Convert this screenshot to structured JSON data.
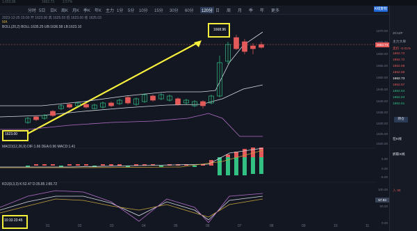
{
  "topbar": {
    "t1": "1,653.96",
    "t2": "1662.73",
    "t3": "2.57%"
  },
  "toolbar": {
    "items": [
      "分时",
      "5日",
      "日K",
      "周K",
      "月K",
      "季K",
      "年K",
      "主力",
      "1分",
      "5分",
      "10分",
      "15分",
      "30分",
      "60分",
      "120分",
      "日",
      "周",
      "月",
      "季",
      "年",
      "更多"
    ],
    "active_index": 14,
    "blue_badge": "K线复权"
  },
  "info": {
    "line1": "2023-12-25 15:00  开 1623.00  高 1625.03  低 1623.00  收 1625.03",
    "ma": "MA",
    "boll": "BOLL(20,2)  BOLL:1635.25  UB:1636.58  LB:1623.10"
  },
  "annotations": {
    "price_top": "1668.96",
    "price_low": "1623.00",
    "time_box": "10:33 23:45"
  },
  "axis": {
    "ticks": [
      "1670.00",
      "1665.00",
      "1660.00",
      "1655.00",
      "1650.00",
      "1645.00",
      "1640.00",
      "1635.00",
      "1630.00",
      "1625.00",
      "1620.00"
    ],
    "last_price": "1662.73",
    "macd_ticks": [
      "5.00",
      "0.00",
      "-5.00"
    ],
    "kdj_ticks": [
      "100.00",
      "50.00",
      "0.00"
    ],
    "kdj_tag": "57.93"
  },
  "panes": {
    "macd": "MACD(12,26,9)  DIF:1.66  DEA:0.96  MACD:1.41",
    "kdj": "KDJ(9,3,3)  K:52.47  D:35.85  J:85.72"
  },
  "xaxis": [
    "01",
    "02",
    "03",
    "04",
    "05",
    "06",
    "07",
    "08",
    "09",
    "10",
    "11"
  ],
  "right_panel": {
    "code": "2C1ZF",
    "name": "主力大单",
    "items": [
      {
        "label": "卖价",
        "value": "-0.01%",
        "color": "#e45a5a"
      },
      {
        "label": "",
        "value": "1662.73",
        "color": "#e45a5a"
      },
      {
        "label": "",
        "value": "1662.72",
        "color": "#e45a5a"
      },
      {
        "label": "",
        "value": "1662.69",
        "color": "#e45a5a"
      },
      {
        "label": "",
        "value": "1662.68",
        "color": "#e45a5a"
      },
      {
        "label": "",
        "value": "1662.73",
        "color": "#ffffff"
      },
      {
        "label": "",
        "value": "1662.67",
        "color": "#e45a5a"
      },
      {
        "label": "",
        "value": "1662.64",
        "color": "#33c083"
      },
      {
        "label": "",
        "value": "1662.63",
        "color": "#33c083"
      },
      {
        "label": "",
        "value": "1662.61",
        "color": "#33c083"
      }
    ],
    "btn": "持仓",
    "section1": "在K线",
    "section2": "抓取K线",
    "tail": "入 30"
  },
  "colors": {
    "up": "#e45a5a",
    "down": "#33c083",
    "highlight": "#f6ef3c"
  }
}
